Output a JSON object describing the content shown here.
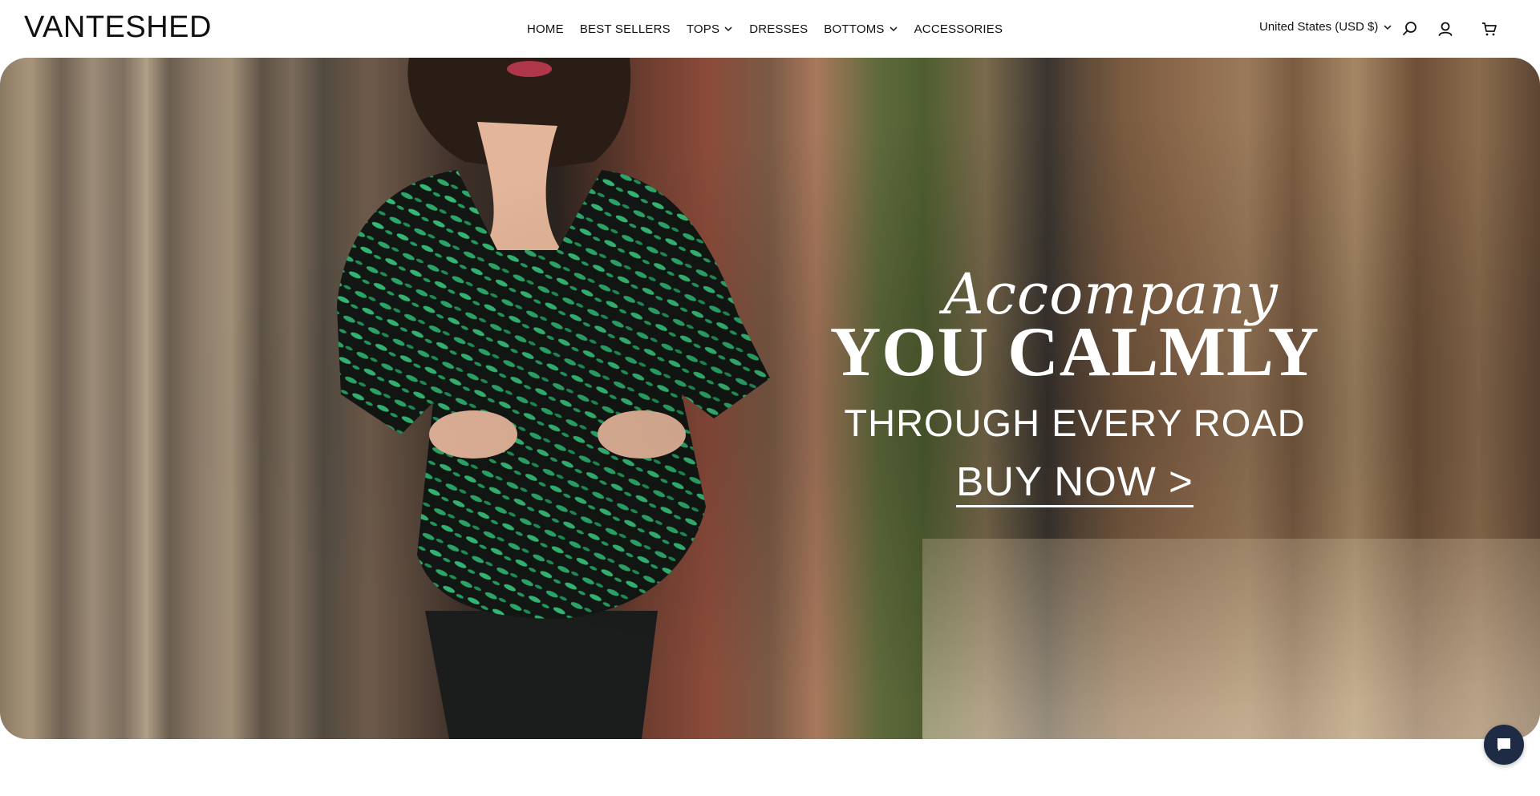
{
  "brand": {
    "logo": "VANTESHED"
  },
  "nav": {
    "items": [
      {
        "label": "HOME",
        "has_dropdown": false
      },
      {
        "label": "BEST SELLERS",
        "has_dropdown": false
      },
      {
        "label": "TOPS",
        "has_dropdown": true
      },
      {
        "label": "DRESSES",
        "has_dropdown": false
      },
      {
        "label": "BOTTOMS",
        "has_dropdown": true
      },
      {
        "label": "ACCESSORIES",
        "has_dropdown": false
      }
    ]
  },
  "utilities": {
    "currency": "United States (USD $)",
    "icons": [
      "search-icon",
      "account-icon",
      "cart-icon"
    ]
  },
  "hero": {
    "script_text": "Accompany",
    "headline": "YOU CALMLY",
    "subheadline": "THROUGH EVERY ROAD",
    "cta": "BUY NOW >"
  },
  "chat": {
    "icon": "chat-icon",
    "color": "#1f2a44"
  }
}
